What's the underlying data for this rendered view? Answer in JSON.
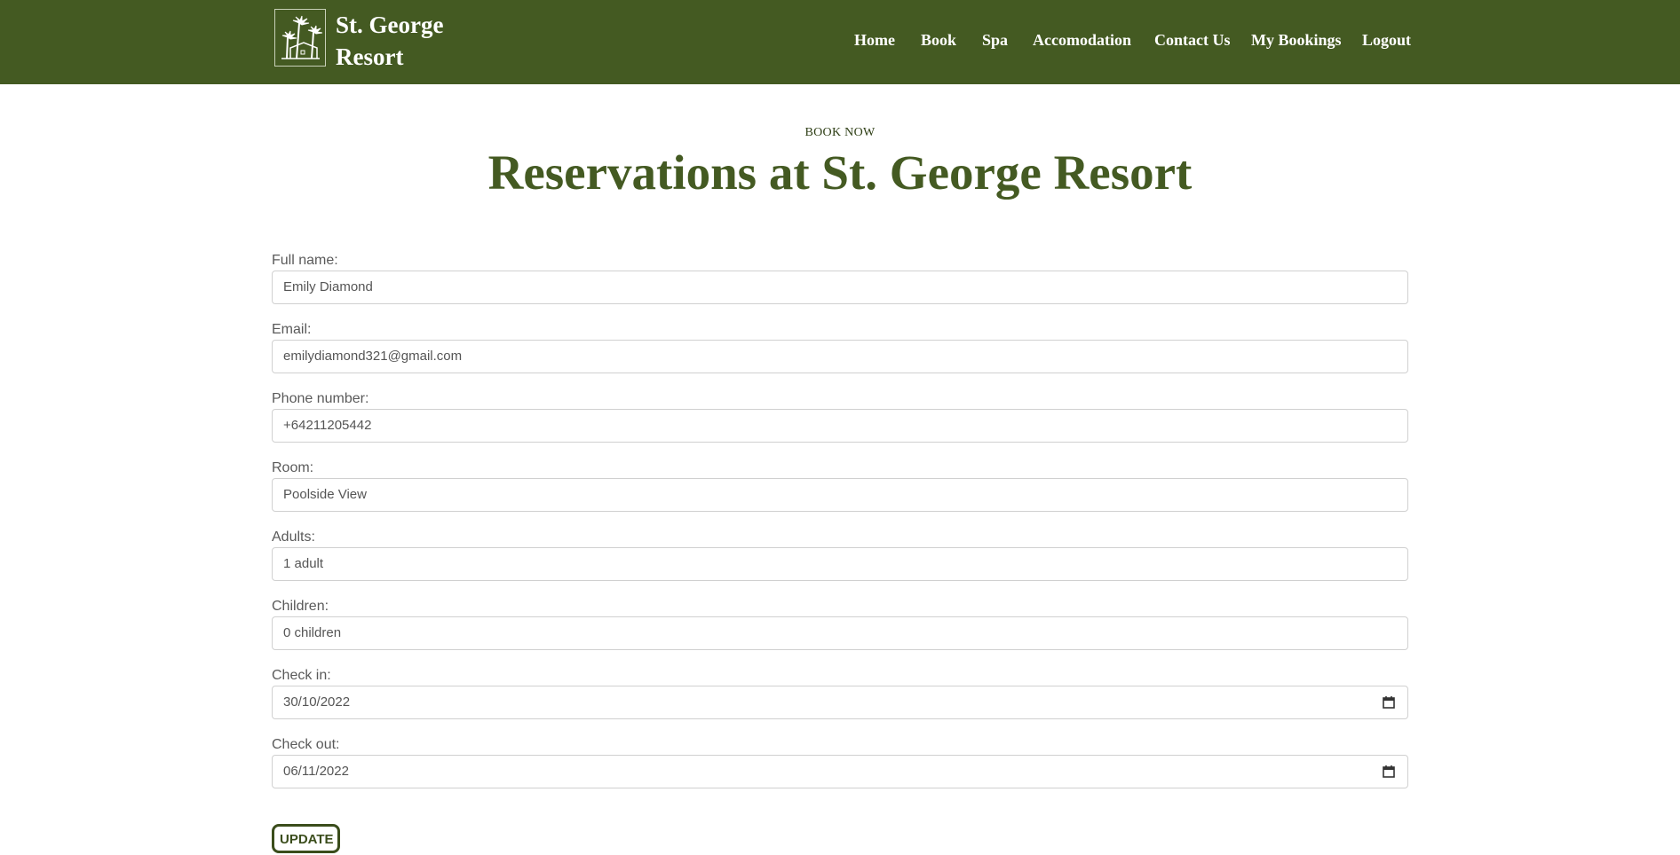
{
  "brand": {
    "line1": "St. George",
    "line2": "Resort"
  },
  "nav": {
    "home": "Home",
    "book": "Book",
    "spa": "Spa",
    "accomodation": "Accomodation",
    "contact": "Contact Us",
    "my_bookings": "My Bookings",
    "logout": "Logout"
  },
  "hero": {
    "eyebrow": "BOOK NOW",
    "title": "Reservations at St. George Resort"
  },
  "form": {
    "full_name": {
      "label": "Full name:",
      "value": "Emily Diamond"
    },
    "email": {
      "label": "Email:",
      "value": "emilydiamond321@gmail.com"
    },
    "phone": {
      "label": "Phone number:",
      "value": "+64211205442"
    },
    "room": {
      "label": "Room:",
      "value": "Poolside View"
    },
    "adults": {
      "label": "Adults:",
      "value": "1 adult"
    },
    "children": {
      "label": "Children:",
      "value": "0 children"
    },
    "check_in": {
      "label": "Check in:",
      "value": "30/10/2022"
    },
    "check_out": {
      "label": "Check out:",
      "value": "06/11/2022"
    },
    "submit_label": "UPDATE"
  },
  "colors": {
    "primary": "#445a22",
    "button_border": "#3b4d1c"
  },
  "icons": {
    "logo": "palm-trees-house-icon",
    "date_picker": "calendar-icon"
  }
}
